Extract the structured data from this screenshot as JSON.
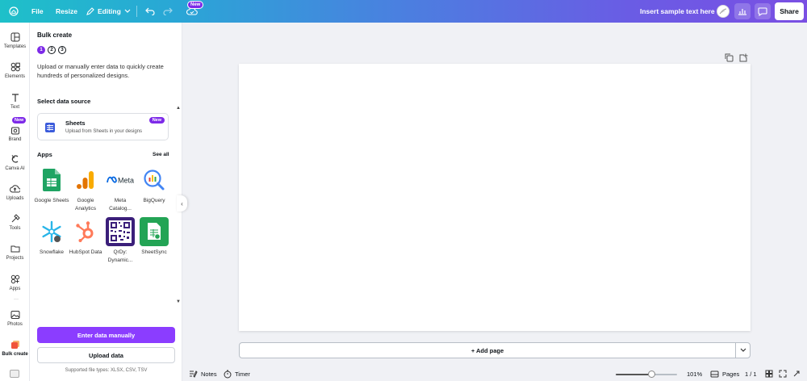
{
  "topbar": {
    "file_label": "File",
    "resize_label": "Resize",
    "editing_label": "Editing",
    "new_badge": "New",
    "sample_text": "Insert sample text here",
    "share_label": "Share",
    "gradient": [
      "#1ec0c9",
      "#7a4fe3"
    ]
  },
  "rail": {
    "items": [
      {
        "label": "Templates",
        "icon": "templates-icon"
      },
      {
        "label": "Elements",
        "icon": "elements-icon"
      },
      {
        "label": "Text",
        "icon": "text-icon"
      },
      {
        "label": "Brand",
        "icon": "brand-icon"
      },
      {
        "label": "Canva AI",
        "icon": "canva-ai-icon"
      },
      {
        "label": "Uploads",
        "icon": "uploads-icon"
      },
      {
        "label": "Tools",
        "icon": "tools-icon"
      },
      {
        "label": "Projects",
        "icon": "projects-icon"
      },
      {
        "label": "Apps",
        "icon": "apps-icon"
      },
      {
        "label": "Photos",
        "icon": "photos-icon"
      },
      {
        "label": "Bulk create",
        "icon": "bulk-create-icon"
      }
    ],
    "new_badge": "New",
    "dots": "···"
  },
  "panel": {
    "title": "Bulk create",
    "steps": [
      "1",
      "2",
      "3"
    ],
    "description": "Upload or manually enter data to quickly create hundreds of personalized designs.",
    "source_title": "Select data source",
    "sheets_title": "Sheets",
    "sheets_sub": "Upload from Sheets in your designs",
    "sheets_badge": "New",
    "apps_title": "Apps",
    "see_all": "See all",
    "apps": [
      {
        "name": "Google Sheets"
      },
      {
        "name": "Google Analytics"
      },
      {
        "name": "Meta Catalog..."
      },
      {
        "name": "BigQuery"
      },
      {
        "name": "Snowflake"
      },
      {
        "name": "HubSpot Data"
      },
      {
        "name": "QrDy: Dynamic..."
      },
      {
        "name": "SheetSync"
      }
    ],
    "enter_manually": "Enter data manually",
    "upload_data": "Upload data",
    "file_types": "Supported file types: XLSX, CSV, TSV",
    "accent": "#8b3dff"
  },
  "canvas": {
    "add_page": "+ Add page"
  },
  "bottombar": {
    "notes": "Notes",
    "timer": "Timer",
    "zoom": "101%",
    "zoom_fraction": 0.58,
    "pages_label": "Pages",
    "page_count": "1 / 1"
  }
}
